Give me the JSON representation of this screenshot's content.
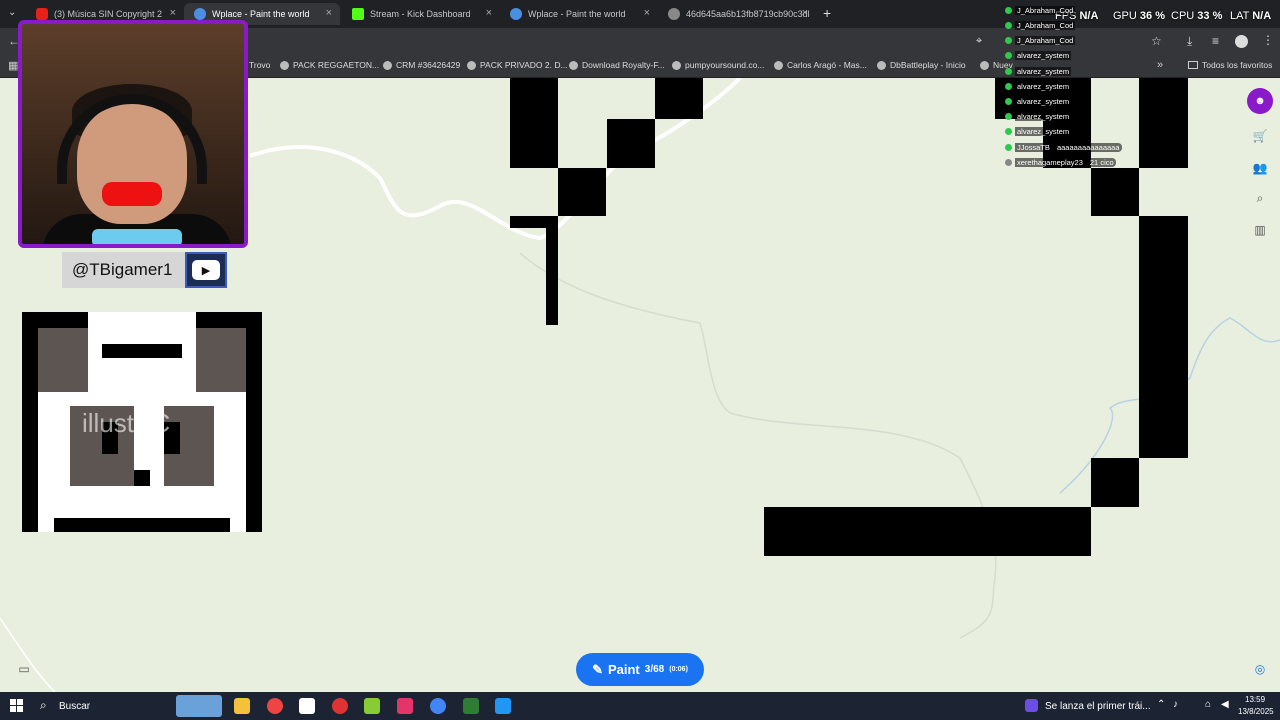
{
  "tabs": [
    {
      "title": "(3) Música SIN Copyright 2",
      "color": "#e62117"
    },
    {
      "title": "Wplace - Paint the world",
      "color": "#4a90e2",
      "active": true
    },
    {
      "title": "Stream - Kick Dashboard",
      "color": "#53fc18"
    },
    {
      "title": "Wplace - Paint the world",
      "color": "#4a90e2"
    },
    {
      "title": "46d645aa6b13fb8719cb90c3dl",
      "color": "#888888"
    }
  ],
  "bookmarks": [
    "Trovo",
    "PACK REGGAETON...",
    "CRM #36426429",
    "PACK PRIVADO 2. D...",
    "Download Royalty-F...",
    "pumpyoursound.co...",
    "Carlos Aragó - Mas...",
    "DbBattleplay - Inicio",
    "Nuev",
    "Todos los favoritos"
  ],
  "stream_stats": {
    "fps_label": "FPS",
    "fps": "N/A",
    "gpu_label": "GPU",
    "gpu": "36 %",
    "cpu_label": "CPU",
    "cpu": "33 %",
    "lat_label": "LAT",
    "lat": "N/A"
  },
  "chat": [
    {
      "user": "J_Abraham_Cod"
    },
    {
      "user": "J_Abraham_Cod"
    },
    {
      "user": "J_Abraham_Cod"
    },
    {
      "user": "alvarez_system"
    },
    {
      "user": "alvarez_system"
    },
    {
      "user": "alvarez_system"
    },
    {
      "user": "alvarez_system"
    },
    {
      "user": "alvarez_system"
    },
    {
      "user": "alvarez_system"
    },
    {
      "user": "JJossaTB",
      "msg": "aaaaaaaaaaaaaaa"
    },
    {
      "user": "xerethagameplay23",
      "msg": "21 cico"
    }
  ],
  "overlay": {
    "handle": "@TBigamer1",
    "watermark": "illustAC"
  },
  "paint_button": {
    "label": "Paint",
    "count": "3/68",
    "timer": "(0:06)"
  },
  "taskbar": {
    "search": "Buscar",
    "news": "Se lanza el primer trái...",
    "time": "13:59",
    "date": "13/8/2025"
  }
}
